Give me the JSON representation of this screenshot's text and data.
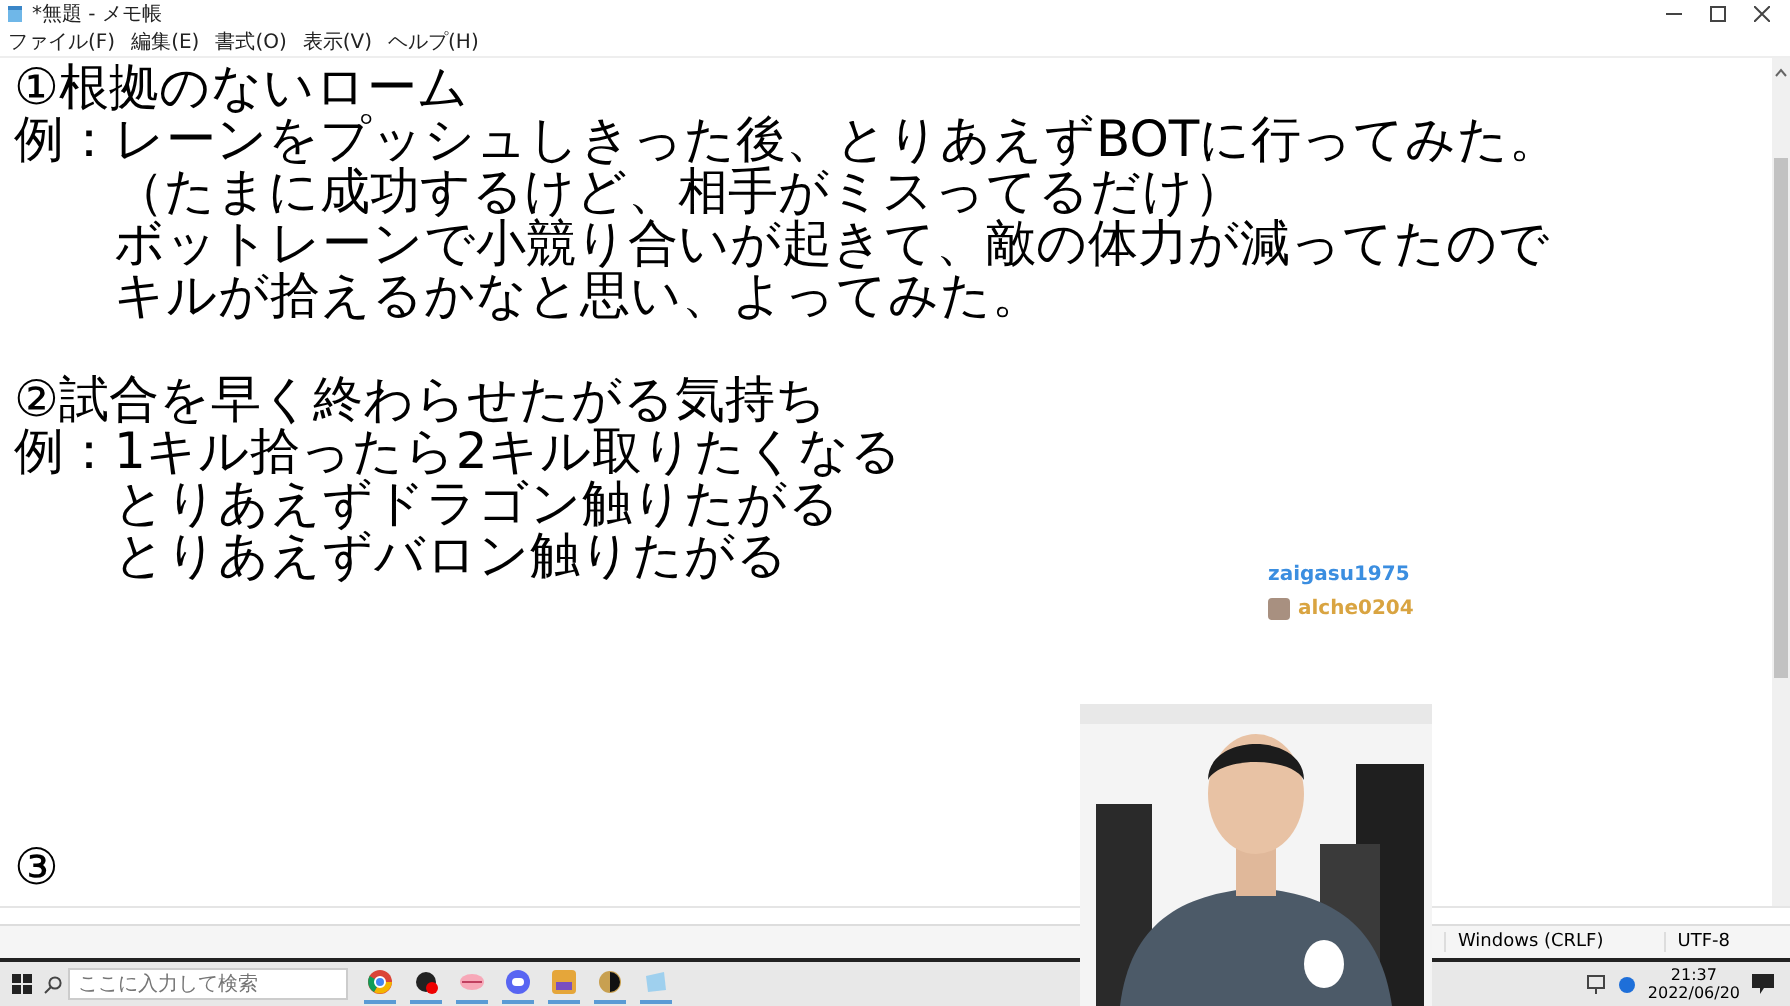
{
  "window": {
    "title": "*無題 - メモ帳"
  },
  "menu": [
    "ファイル(F)",
    "編集(E)",
    "書式(O)",
    "表示(V)",
    "ヘルプ(H)"
  ],
  "lines": [
    {
      "kind": "text",
      "text": "①根拠のないローム"
    },
    {
      "kind": "text",
      "text": "例：レーンをプッシュしきった後、とりあえずBOTに行ってみた。"
    },
    {
      "kind": "text",
      "text": "　　（たまに成功するけど、相手がミスってるだけ）"
    },
    {
      "kind": "text",
      "text": "　　ボットレーンで小競り合いが起きて、敵の体力が減ってたので"
    },
    {
      "kind": "text",
      "text": "　　キルが拾えるかなと思い、よってみた。"
    },
    {
      "kind": "blank"
    },
    {
      "kind": "text",
      "text": "②試合を早く終わらせたがる気持ち"
    },
    {
      "kind": "text",
      "text": "例：1キル拾ったら2キル取りたくなる"
    },
    {
      "kind": "text",
      "text": "　　とりあえずドラゴン触りたがる"
    },
    {
      "kind": "text",
      "text": "　　とりあえずバロン触りたがる"
    },
    {
      "kind": "blank"
    },
    {
      "kind": "blank"
    },
    {
      "kind": "blank"
    },
    {
      "kind": "blank"
    },
    {
      "kind": "blank"
    },
    {
      "kind": "text",
      "text": "③"
    }
  ],
  "status_bar": {
    "line_ending": "Windows (CRLF)",
    "encoding": "UTF-8"
  },
  "chat": [
    {
      "user": "zaigasu1975",
      "color": "#3b8ee0"
    },
    {
      "user": "alche0204",
      "color": "#d9a441"
    }
  ],
  "taskbar": {
    "search": {
      "placeholder": "ここに入力して検索"
    },
    "time": "21:37",
    "date": "2022/06/20"
  }
}
